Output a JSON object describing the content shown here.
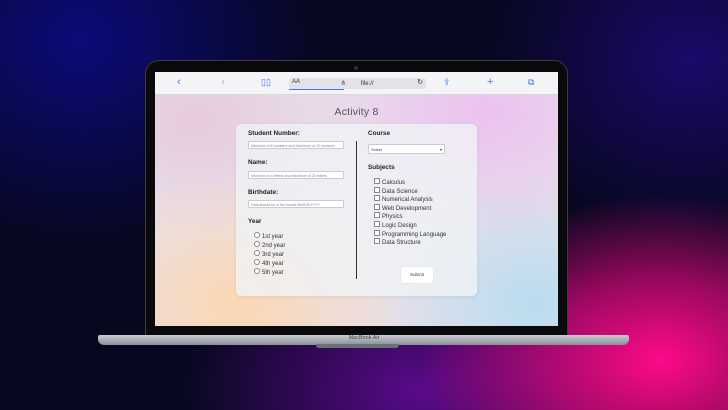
{
  "device": {
    "brand_label": "MacBook Air"
  },
  "browser": {
    "address_prefix": "AA",
    "address_url": "ð file://",
    "icons": [
      "back-icon",
      "forward-icon",
      "bookmarks-icon",
      "reload-icon",
      "share-icon",
      "new-tab-icon",
      "tabs-icon"
    ]
  },
  "page": {
    "title": "Activity 8",
    "form": {
      "student_number": {
        "label": "Student Number:",
        "placeholder": "Minimum of 8 numbers and Maximum of 12 numbers"
      },
      "name": {
        "label": "Name:",
        "placeholder": "Minimum of 4 letters and Maximum of 20 letters"
      },
      "birthdate": {
        "label": "Birthdate:",
        "placeholder": "Data should be in the format MM/DD/YYYY"
      },
      "year": {
        "label": "Year",
        "options": [
          "1st year",
          "2nd year",
          "3rd year",
          "4th year",
          "5th year"
        ]
      },
      "course": {
        "label": "Course",
        "selected": "Select"
      },
      "subjects": {
        "label": "Subjects",
        "options": [
          "Calculus",
          "Data Science",
          "Numerical Analysis",
          "Web Development",
          "Physics",
          "Logic Design",
          "Programming Language",
          "Data Structure"
        ]
      },
      "submit_label": "Submit"
    }
  }
}
